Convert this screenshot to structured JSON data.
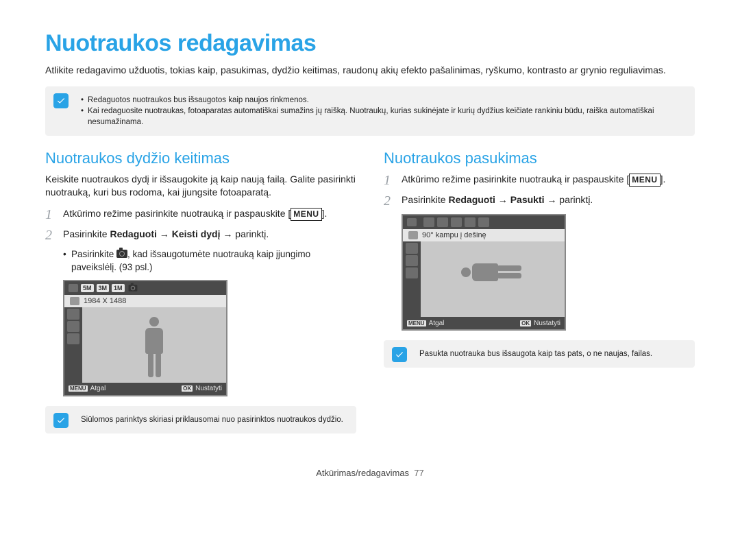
{
  "title": "Nuotraukos redagavimas",
  "intro": "Atlikite redagavimo užduotis, tokias kaip, pasukimas, dydžio keitimas, raudonų akių efekto pašalinimas, ryškumo, kontrasto ar grynio reguliavimas.",
  "top_notes": [
    "Redaguotos nuotraukos bus išsaugotos kaip naujos rinkmenos.",
    "Kai redaguosite nuotraukas, fotoaparatas automatiškai sumažins jų raišką. Nuotraukų, kurias sukinėjate ir kurių dydžius keičiate rankiniu būdu, raiška automatiškai nesumažinama."
  ],
  "left": {
    "heading": "Nuotraukos dydžio keitimas",
    "body": "Keiskite nuotraukos dydį ir išsaugokite ją kaip naują failą. Galite pasirinkti nuotrauką, kuri bus rodoma, kai įjungsite fotoaparatą.",
    "step1_pre": "Atkūrimo režime pasirinkite nuotrauką ir paspauskite ",
    "menu_label": "MENU",
    "step2_pre": "Pasirinkite ",
    "step2_b1": "Redaguoti",
    "step2_arrow": " → ",
    "step2_b2": "Keisti dydį",
    "step2_post": " → parinktį.",
    "bullet_pre": "Pasirinkite ",
    "bullet_post": ", kad išsaugotumėte nuotrauką kaip įjungimo paveikslėlį. (93 psl.)",
    "screen": {
      "badges": [
        "5M",
        "3M",
        "1M"
      ],
      "info": "1984 X 1488",
      "back_badge": "MENU",
      "back": "Atgal",
      "ok_badge": "OK",
      "set": "Nustatyti"
    },
    "note": "Siūlomos parinktys skiriasi priklausomai nuo pasirinktos nuotraukos dydžio."
  },
  "right": {
    "heading": "Nuotraukos pasukimas",
    "step1_pre": "Atkūrimo režime pasirinkite nuotrauką ir paspauskite ",
    "menu_label": "MENU",
    "step2_pre": "Pasirinkite ",
    "step2_b1": "Redaguoti",
    "step2_arrow": " → ",
    "step2_b2": "Pasukti",
    "step2_post": " → parinktį.",
    "screen": {
      "info": "90° kampu į dešinę",
      "back_badge": "MENU",
      "back": "Atgal",
      "ok_badge": "OK",
      "set": "Nustatyti"
    },
    "note": "Pasukta nuotrauka bus išsaugota kaip tas pats, o ne naujas, failas."
  },
  "footer": {
    "section": "Atkūrimas/redagavimas",
    "page": "77"
  },
  "nums": {
    "one": "1",
    "two": "2"
  },
  "period": "."
}
